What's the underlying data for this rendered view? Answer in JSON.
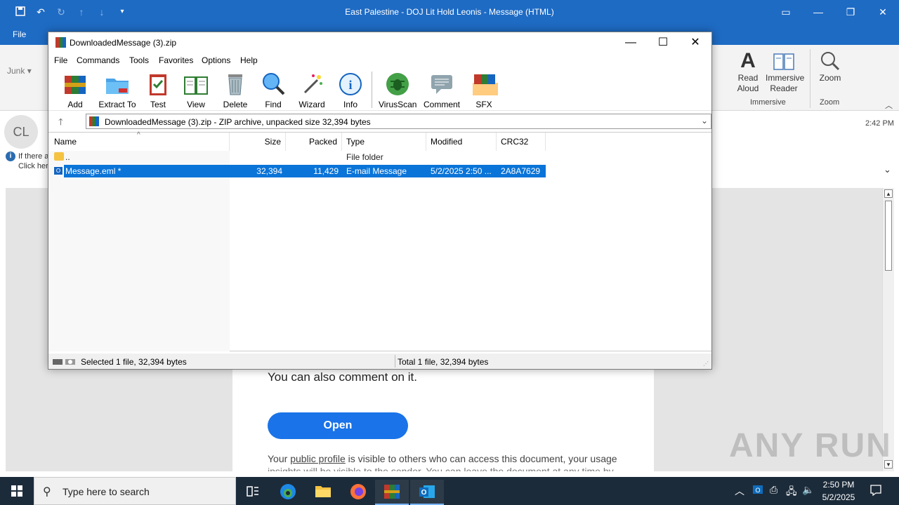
{
  "outlook": {
    "window_title": "East Palestine - DOJ Lit Hold Leonis  -  Message (HTML)",
    "file_tab": "File",
    "junk_label": "Junk",
    "ribbon": {
      "read_aloud": "Read\nAloud",
      "immersive_reader": "Immersive\nReader",
      "immersive_group": "Immersive",
      "zoom": "Zoom",
      "zoom_group": "Zoom"
    },
    "avatar_initials": "CL",
    "time": "2:42 PM",
    "info_line1": "If there a",
    "info_line2": "Click her",
    "body": {
      "comment_text": "You can also comment on it.",
      "open_button": "Open",
      "privacy_pre": "Your ",
      "privacy_link": "public profile",
      "privacy_post": " is visible to others who can access this document, your usage",
      "privacy_line2": "insights will be visible to the sender. You can leave the document at any time by"
    },
    "watermark": "ANY RUN"
  },
  "winrar": {
    "title": "DownloadedMessage (3).zip",
    "menu": [
      "File",
      "Commands",
      "Tools",
      "Favorites",
      "Options",
      "Help"
    ],
    "toolbar": [
      "Add",
      "Extract To",
      "Test",
      "View",
      "Delete",
      "Find",
      "Wizard",
      "Info",
      "VirusScan",
      "Comment",
      "SFX"
    ],
    "path": "DownloadedMessage (3).zip - ZIP archive, unpacked size 32,394 bytes",
    "columns": [
      "Name",
      "Size",
      "Packed",
      "Type",
      "Modified",
      "CRC32"
    ],
    "rows": [
      {
        "name": "..",
        "size": "",
        "packed": "",
        "type": "File folder",
        "modified": "",
        "crc": ""
      },
      {
        "name": "Message.eml *",
        "size": "32,394",
        "packed": "11,429",
        "type": "E-mail Message",
        "modified": "5/2/2025 2:50 ...",
        "crc": "2A8A7629"
      }
    ],
    "status_left": "Selected 1 file, 32,394 bytes",
    "status_right": "Total 1 file, 32,394 bytes"
  },
  "taskbar": {
    "search_placeholder": "Type here to search",
    "time": "2:50 PM",
    "date": "5/2/2025"
  },
  "colors": {
    "outlook_blue": "#1e6bc4",
    "selection": "#0a74d8",
    "open_button": "#1a73e8",
    "taskbar": "#1c2b3a"
  }
}
